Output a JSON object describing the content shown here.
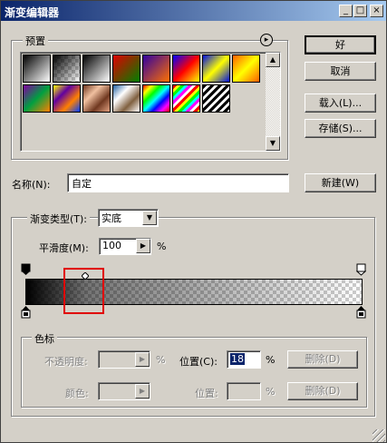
{
  "window": {
    "title": "渐变编辑器"
  },
  "titlebar_buttons": {
    "minimize": "_",
    "maximize": "□",
    "close": "×"
  },
  "presets": {
    "label": "预置",
    "menu_glyph": "▸",
    "swatches": [
      {
        "name": "foreground-to-background",
        "css": "linear-gradient(135deg,#000,#fff)"
      },
      {
        "name": "foreground-to-transparent",
        "css": "linear-gradient(135deg,#000,transparent)"
      },
      {
        "name": "black-white",
        "css": "linear-gradient(135deg,#000,#fff)"
      },
      {
        "name": "red-green",
        "css": "linear-gradient(135deg,#e00000,#008000)"
      },
      {
        "name": "violet-orange",
        "css": "linear-gradient(135deg,#3000a0,#ff7000)"
      },
      {
        "name": "blue-red-yellow",
        "css": "linear-gradient(135deg,#0000ff,#ff0000,#ffff00)"
      },
      {
        "name": "blue-yellow-blue",
        "css": "linear-gradient(135deg,#0010e0,#ffff00,#0010e0)"
      },
      {
        "name": "orange-yellow-orange",
        "css": "linear-gradient(135deg,#ff6000,#ffff00,#ff6000)"
      },
      {
        "name": "violet-green-orange",
        "css": "linear-gradient(135deg,#8000a0,#00a040,#ff8000)"
      },
      {
        "name": "yellow-violet-orange-blue",
        "css": "linear-gradient(135deg,#ffff00,#6000a0,#ff8000,#0040ff)"
      },
      {
        "name": "copper",
        "css": "linear-gradient(135deg,#703820,#f0c0a0,#703820,#e0a080)"
      },
      {
        "name": "chrome",
        "css": "linear-gradient(135deg,#2060a0,#ffffff,#806040,#ffffff)"
      },
      {
        "name": "spectrum",
        "css": "linear-gradient(135deg,#ff0000,#ffff00,#00ff00,#00ffff,#0000ff,#ff00ff,#ff0000)"
      },
      {
        "name": "transparent-rainbow",
        "css": "repeating-linear-gradient(135deg,#ff0000 0 3px,#ffff00 3px 6px,#00ff00 6px 9px,#00ffff 9px 12px,#ff00ff 12px 15px,#ffffff 15px 18px)"
      },
      {
        "name": "transparent-stripes",
        "css": "repeating-linear-gradient(135deg,#000 0 3px,#fff 3px 6px)"
      }
    ]
  },
  "buttons": {
    "ok": "好",
    "cancel": "取消",
    "load": "载入(L)...",
    "save": "存储(S)...",
    "new": "新建(W)"
  },
  "name_field": {
    "label": "名称(N):",
    "value": "自定"
  },
  "gradient_type": {
    "label": "渐变类型(T):",
    "value": "实底"
  },
  "smoothness": {
    "label": "平滑度(M):",
    "value": "100",
    "unit": "%"
  },
  "gradient_bar": {
    "start_color": "#000000",
    "start_opacity_percent": 100,
    "end_opacity_percent": 0,
    "midpoint_percent": 18
  },
  "stops": {
    "label": "色标",
    "opacity_label": "不透明度:",
    "opacity_value": "",
    "opacity_unit": "%",
    "location_label": "位置(C):",
    "location_value": "18",
    "location_unit": "%",
    "delete_label": "删除(D)",
    "color_label": "颜色:",
    "color_location_label": "位置:",
    "color_location_value": "",
    "color_location_unit": "%",
    "color_delete_label": "删除(D)"
  }
}
